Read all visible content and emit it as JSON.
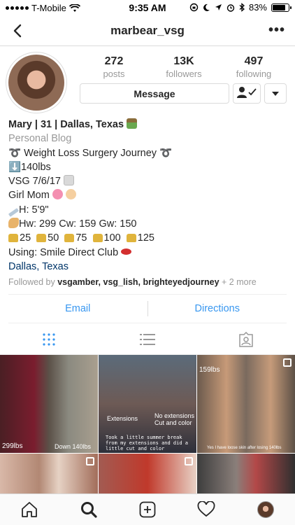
{
  "status_bar": {
    "carrier": "T-Mobile",
    "time": "9:35 AM",
    "battery": "83%",
    "battery_level": 0.83
  },
  "nav": {
    "title": "marbear_vsg",
    "more": "•••"
  },
  "profile": {
    "stats": [
      {
        "value": "272",
        "label": "posts"
      },
      {
        "value": "13K",
        "label": "followers"
      },
      {
        "value": "497",
        "label": "following"
      }
    ],
    "message_label": "Message"
  },
  "bio": {
    "name": "Mary | 31 | Dallas, Texas",
    "category": "Personal Blog",
    "lines": [
      "➰ Weight Loss Surgery Journey ➰",
      "⬇️140lbs",
      "VSG 7/6/17",
      "Girl Mom",
      "H: 5'9\"",
      "Hw: 299 Cw: 159 Gw: 150",
      "25  50  75  100  125",
      "Using: Smile Direct Club"
    ],
    "location": "Dallas, Texas",
    "followed_by_prefix": "Followed by",
    "followed_by_users": "vsgamber, vsg_lish, brighteyedjourney",
    "followed_by_more": "+ 2 more"
  },
  "contact": {
    "email": "Email",
    "directions": "Directions"
  },
  "grid": {
    "captions": {
      "c1_a": "299lbs",
      "c1_b": "Down 140lbs",
      "c2_a": "Extensions",
      "c2_b": "No extensions\nCut and color",
      "c2_c": "Took a little summer break from my extensions and did a little cut and color",
      "c3_a": "159lbs",
      "c3_b": "Yes I have loose skin after losing 140lbs"
    }
  },
  "colors": {
    "link_blue": "#3897f0",
    "location_blue": "#003569",
    "muted_gray": "#999999"
  }
}
